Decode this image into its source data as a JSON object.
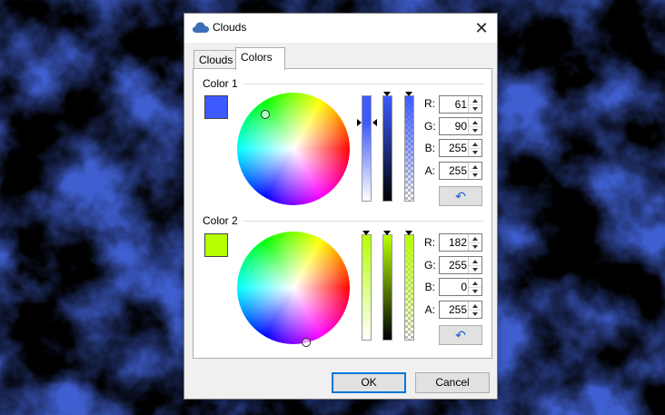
{
  "window": {
    "title": "Clouds",
    "close_label": "✕",
    "icon": "cloud-icon"
  },
  "tabs": [
    {
      "label": "Clouds",
      "active": false
    },
    {
      "label": "Colors",
      "active": true
    }
  ],
  "color1": {
    "label": "Color 1",
    "swatch_color": "#3d5aff",
    "fields": {
      "r_label": "R:",
      "g_label": "G:",
      "b_label": "B:",
      "a_label": "A:"
    },
    "values": {
      "r": "61",
      "g": "90",
      "b": "255",
      "a": "255"
    },
    "reset_icon": "reset-arrow-icon"
  },
  "color2": {
    "label": "Color 2",
    "swatch_color": "#b6ff00",
    "fields": {
      "r_label": "R:",
      "g_label": "G:",
      "b_label": "B:",
      "a_label": "A:"
    },
    "values": {
      "r": "182",
      "g": "255",
      "b": "0",
      "a": "255"
    },
    "reset_icon": "reset-arrow-icon"
  },
  "buttons": {
    "ok": "OK",
    "cancel": "Cancel"
  },
  "colors": {
    "accent": "#0078d7",
    "background_blue": "#3f5fd0",
    "background_green": "#9ecb2a"
  }
}
